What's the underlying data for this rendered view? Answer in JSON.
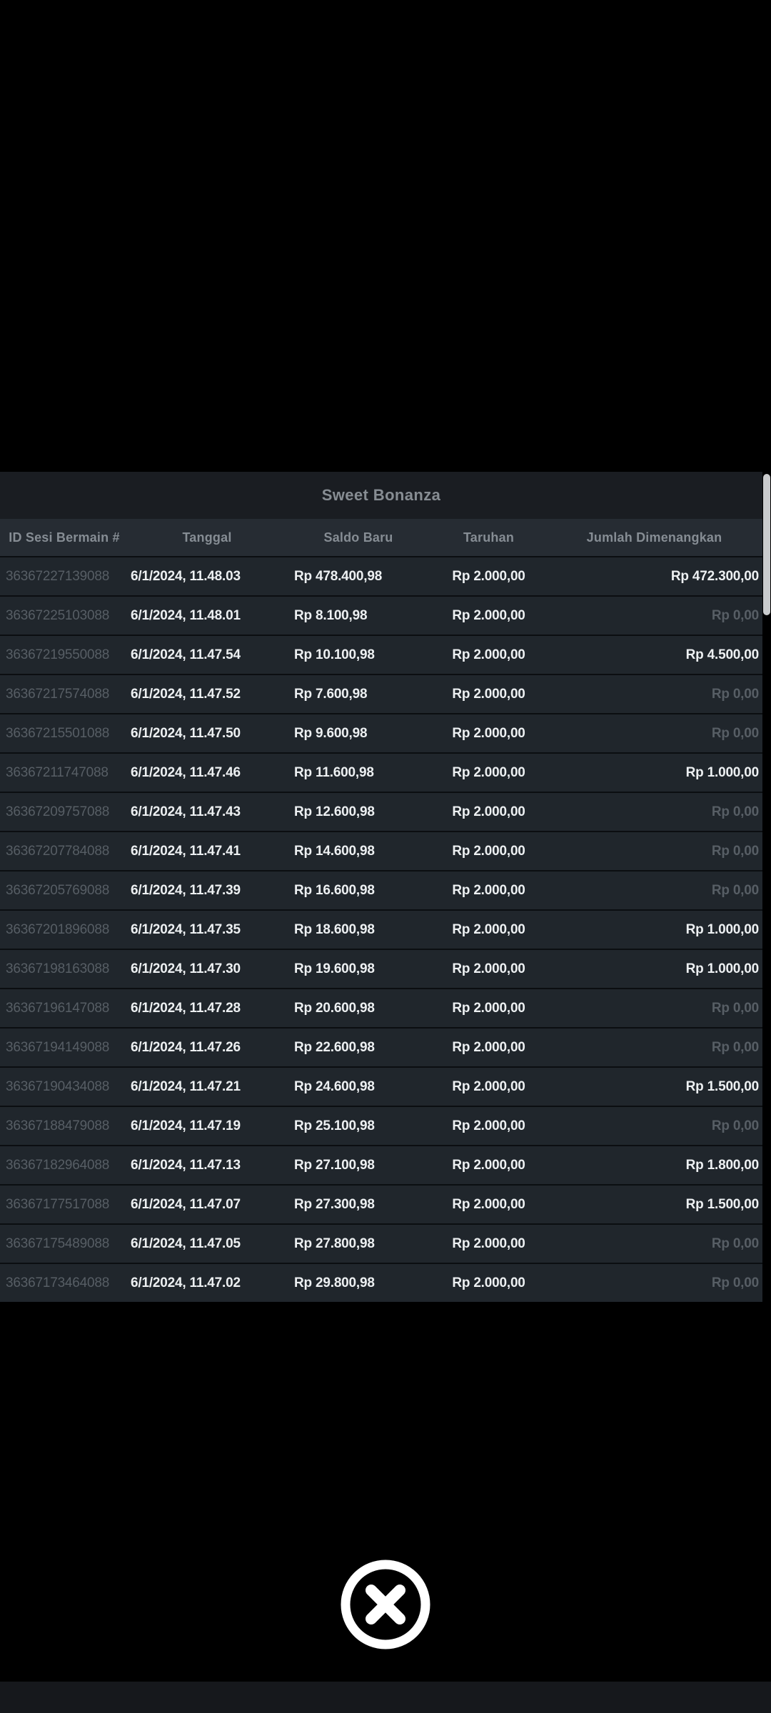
{
  "modal": {
    "title": "Sweet Bonanza"
  },
  "table": {
    "columns": [
      "ID Sesi Bermain #",
      "Tanggal",
      "Saldo Baru",
      "Taruhan",
      "Jumlah Dimenangkan"
    ],
    "zero_win_value": "Rp 0,00",
    "rows": [
      {
        "session_id": "36367227139088",
        "date": "6/1/2024, 11.48.03",
        "new_balance": "Rp 478.400,98",
        "bet": "Rp 2.000,00",
        "win": "Rp 472.300,00"
      },
      {
        "session_id": "36367225103088",
        "date": "6/1/2024, 11.48.01",
        "new_balance": "Rp 8.100,98",
        "bet": "Rp 2.000,00",
        "win": "Rp 0,00"
      },
      {
        "session_id": "36367219550088",
        "date": "6/1/2024, 11.47.54",
        "new_balance": "Rp 10.100,98",
        "bet": "Rp 2.000,00",
        "win": "Rp 4.500,00"
      },
      {
        "session_id": "36367217574088",
        "date": "6/1/2024, 11.47.52",
        "new_balance": "Rp 7.600,98",
        "bet": "Rp 2.000,00",
        "win": "Rp 0,00"
      },
      {
        "session_id": "36367215501088",
        "date": "6/1/2024, 11.47.50",
        "new_balance": "Rp 9.600,98",
        "bet": "Rp 2.000,00",
        "win": "Rp 0,00"
      },
      {
        "session_id": "36367211747088",
        "date": "6/1/2024, 11.47.46",
        "new_balance": "Rp 11.600,98",
        "bet": "Rp 2.000,00",
        "win": "Rp 1.000,00"
      },
      {
        "session_id": "36367209757088",
        "date": "6/1/2024, 11.47.43",
        "new_balance": "Rp 12.600,98",
        "bet": "Rp 2.000,00",
        "win": "Rp 0,00"
      },
      {
        "session_id": "36367207784088",
        "date": "6/1/2024, 11.47.41",
        "new_balance": "Rp 14.600,98",
        "bet": "Rp 2.000,00",
        "win": "Rp 0,00"
      },
      {
        "session_id": "36367205769088",
        "date": "6/1/2024, 11.47.39",
        "new_balance": "Rp 16.600,98",
        "bet": "Rp 2.000,00",
        "win": "Rp 0,00"
      },
      {
        "session_id": "36367201896088",
        "date": "6/1/2024, 11.47.35",
        "new_balance": "Rp 18.600,98",
        "bet": "Rp 2.000,00",
        "win": "Rp 1.000,00"
      },
      {
        "session_id": "36367198163088",
        "date": "6/1/2024, 11.47.30",
        "new_balance": "Rp 19.600,98",
        "bet": "Rp 2.000,00",
        "win": "Rp 1.000,00"
      },
      {
        "session_id": "36367196147088",
        "date": "6/1/2024, 11.47.28",
        "new_balance": "Rp 20.600,98",
        "bet": "Rp 2.000,00",
        "win": "Rp 0,00"
      },
      {
        "session_id": "36367194149088",
        "date": "6/1/2024, 11.47.26",
        "new_balance": "Rp 22.600,98",
        "bet": "Rp 2.000,00",
        "win": "Rp 0,00"
      },
      {
        "session_id": "36367190434088",
        "date": "6/1/2024, 11.47.21",
        "new_balance": "Rp 24.600,98",
        "bet": "Rp 2.000,00",
        "win": "Rp 1.500,00"
      },
      {
        "session_id": "36367188479088",
        "date": "6/1/2024, 11.47.19",
        "new_balance": "Rp 25.100,98",
        "bet": "Rp 2.000,00",
        "win": "Rp 0,00"
      },
      {
        "session_id": "36367182964088",
        "date": "6/1/2024, 11.47.13",
        "new_balance": "Rp 27.100,98",
        "bet": "Rp 2.000,00",
        "win": "Rp 1.800,00"
      },
      {
        "session_id": "36367177517088",
        "date": "6/1/2024, 11.47.07",
        "new_balance": "Rp 27.300,98",
        "bet": "Rp 2.000,00",
        "win": "Rp 1.500,00"
      },
      {
        "session_id": "36367175489088",
        "date": "6/1/2024, 11.47.05",
        "new_balance": "Rp 27.800,98",
        "bet": "Rp 2.000,00",
        "win": "Rp 0,00"
      },
      {
        "session_id": "36367173464088",
        "date": "6/1/2024, 11.47.02",
        "new_balance": "Rp 29.800,98",
        "bet": "Rp 2.000,00",
        "win": "Rp 0,00"
      }
    ]
  },
  "icons": {
    "close": "x-circle-icon"
  },
  "colors": {
    "background": "#000000",
    "title_bar_bg": "#1a1d22",
    "header_row_bg": "#262c33",
    "row_bg": "#20262c",
    "divider": "#0b0e11",
    "text_bright": "#edf0f2",
    "text_dim": "#575e65",
    "scrollbar_thumb": "#c9cbcd",
    "close_icon": "#ffffff"
  }
}
